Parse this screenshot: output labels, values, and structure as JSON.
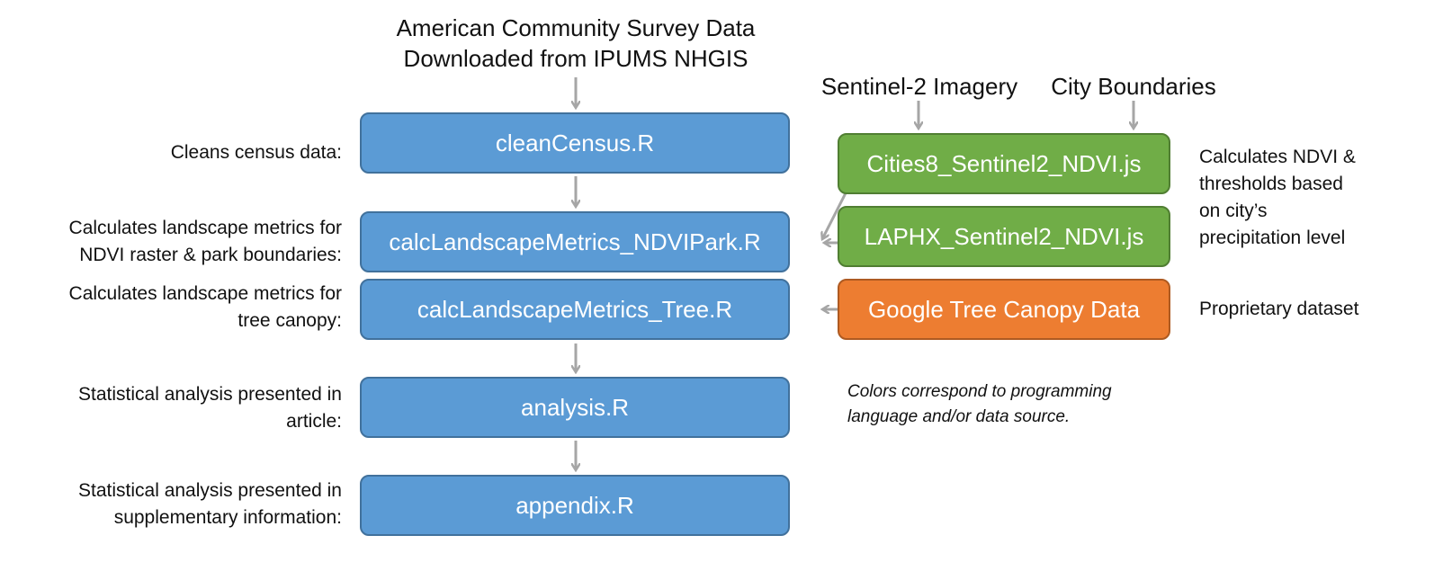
{
  "title": {
    "line1": "American Community Survey Data",
    "line2": "Downloaded from IPUMS NHGIS"
  },
  "sources": {
    "sentinel": "Sentinel-2 Imagery",
    "city": "City Boundaries"
  },
  "blue_boxes": [
    "cleanCensus.R",
    "calcLandscapeMetrics_NDVIPark.R",
    "calcLandscapeMetrics_Tree.R",
    "analysis.R",
    "appendix.R"
  ],
  "left_labels": [
    {
      "l1": "Cleans census data:",
      "l2": ""
    },
    {
      "l1": "Calculates landscape metrics for",
      "l2": "NDVI raster & park boundaries:"
    },
    {
      "l1": "Calculates landscape metrics for",
      "l2": "tree canopy:"
    },
    {
      "l1": "Statistical analysis presented in",
      "l2": "article:"
    },
    {
      "l1": "Statistical analysis presented in",
      "l2": "supplementary information:"
    }
  ],
  "green_boxes": [
    "Cities8_Sentinel2_NDVI.js",
    "LAPHX_Sentinel2_NDVI.js"
  ],
  "orange_box": "Google Tree Canopy Data",
  "right_labels": {
    "ndvi": [
      "Calculates NDVI &",
      "thresholds based",
      "on city’s",
      "precipitation level"
    ],
    "proprietary": "Proprietary dataset"
  },
  "note": {
    "l1": "Colors correspond to programming",
    "l2": "language and/or data source."
  },
  "colors": {
    "blue": "#5B9BD5",
    "green": "#70AD47",
    "orange": "#ED7D31",
    "arrow": "#A6A6A6"
  }
}
